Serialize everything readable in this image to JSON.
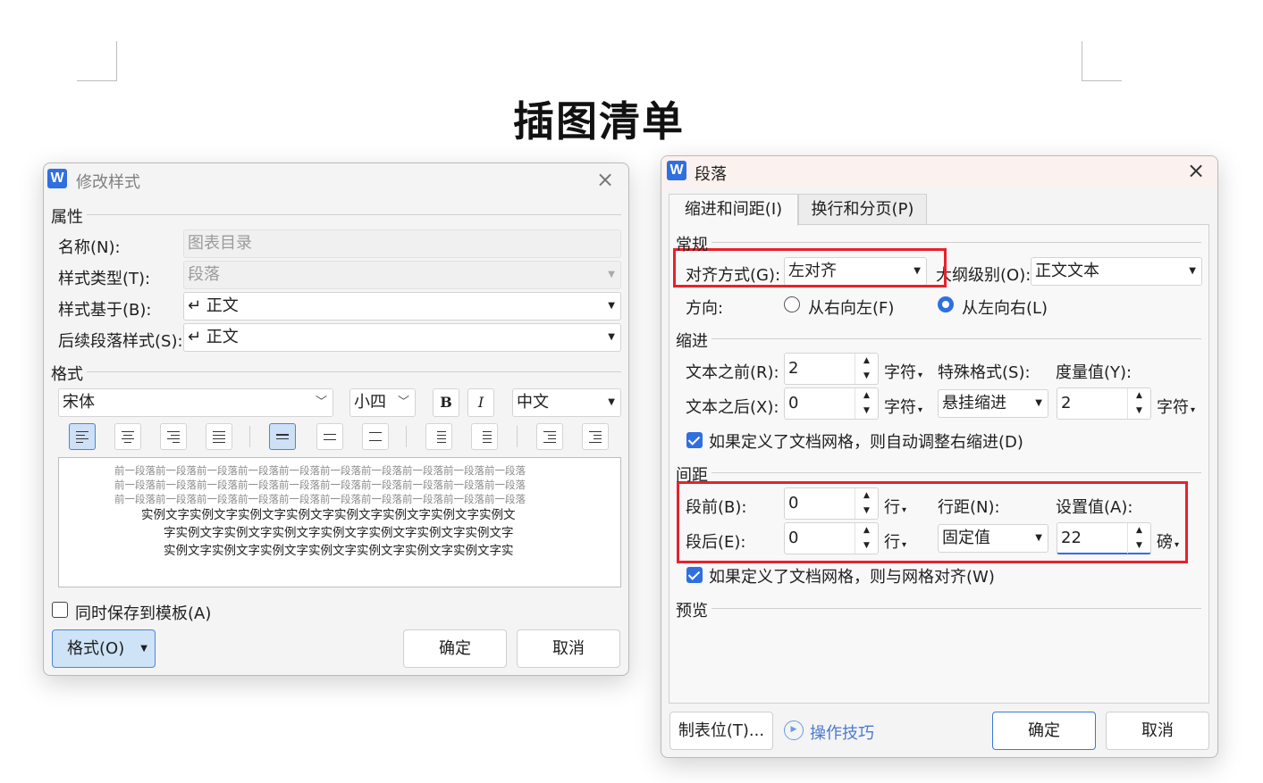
{
  "document": {
    "title": "插图清单"
  },
  "modify_style": {
    "title": "修改样式",
    "close": "×",
    "properties": {
      "header": "属性",
      "name_label": "名称(N):",
      "name_value": "图表目录",
      "type_label": "样式类型(T):",
      "type_value": "段落",
      "based_on_label": "样式基于(B):",
      "based_on_value": "↵ 正文",
      "next_label": "后续段落样式(S):",
      "next_value": "↵ 正文"
    },
    "format": {
      "header": "格式",
      "font": "宋体",
      "size": "小四",
      "bold": "B",
      "italic": "I",
      "script": "中文"
    },
    "preview": {
      "prev_lines": [
        "前一段落前一段落前一段落前一段落前一段落前一段落前一段落前一段落前一段落前一段落",
        "前一段落前一段落前一段落前一段落前一段落前一段落前一段落前一段落前一段落前一段落",
        "前一段落前一段落前一段落前一段落前一段落前一段落前一段落前一段落前一段落前一段落"
      ],
      "sample_lines": [
        "实例文字实例文字实例文字实例文字实例文字实例文字实例文字实例文",
        "字实例文字实例文字实例文字实例文字实例文字实例文字实例文字",
        "实例文字实例文字实例文字实例文字实例文字实例文字实例文字实"
      ]
    },
    "save_template": "同时保存到模板(A)",
    "format_button": "格式(O)",
    "ok": "确定",
    "cancel": "取消"
  },
  "paragraph": {
    "title": "段落",
    "close": "×",
    "tabs": [
      "缩进和间距(I)",
      "换行和分页(P)"
    ],
    "general": {
      "header": "常规",
      "alignment_label": "对齐方式(G):",
      "alignment_value": "左对齐",
      "outline_label": "大纲级别(O):",
      "outline_value": "正文文本",
      "direction_label": "方向:",
      "rtl_label": "从右向左(F)",
      "ltr_label": "从左向右(L)"
    },
    "indent": {
      "header": "缩进",
      "before_label": "文本之前(R):",
      "before_value": "2",
      "before_unit": "字符",
      "after_label": "文本之后(X):",
      "after_value": "0",
      "after_unit": "字符",
      "special_label": "特殊格式(S):",
      "special_value": "悬挂缩进",
      "measure_label": "度量值(Y):",
      "measure_value": "2",
      "measure_unit": "字符",
      "auto_adjust": "如果定义了文档网格，则自动调整右缩进(D)"
    },
    "spacing": {
      "header": "间距",
      "before_label": "段前(B):",
      "before_value": "0",
      "before_unit": "行",
      "after_label": "段后(E):",
      "after_value": "0",
      "after_unit": "行",
      "line_label": "行距(N):",
      "line_value": "固定值",
      "set_label": "设置值(A):",
      "set_value": "22",
      "set_unit": "磅",
      "snap_grid": "如果定义了文档网格，则与网格对齐(W)"
    },
    "preview_header": "预览",
    "tabs_button": "制表位(T)...",
    "tips": "操作技巧",
    "ok": "确定",
    "cancel": "取消"
  },
  "colors": {
    "accent": "#2f6fe0",
    "highlight": "#e8212c"
  }
}
